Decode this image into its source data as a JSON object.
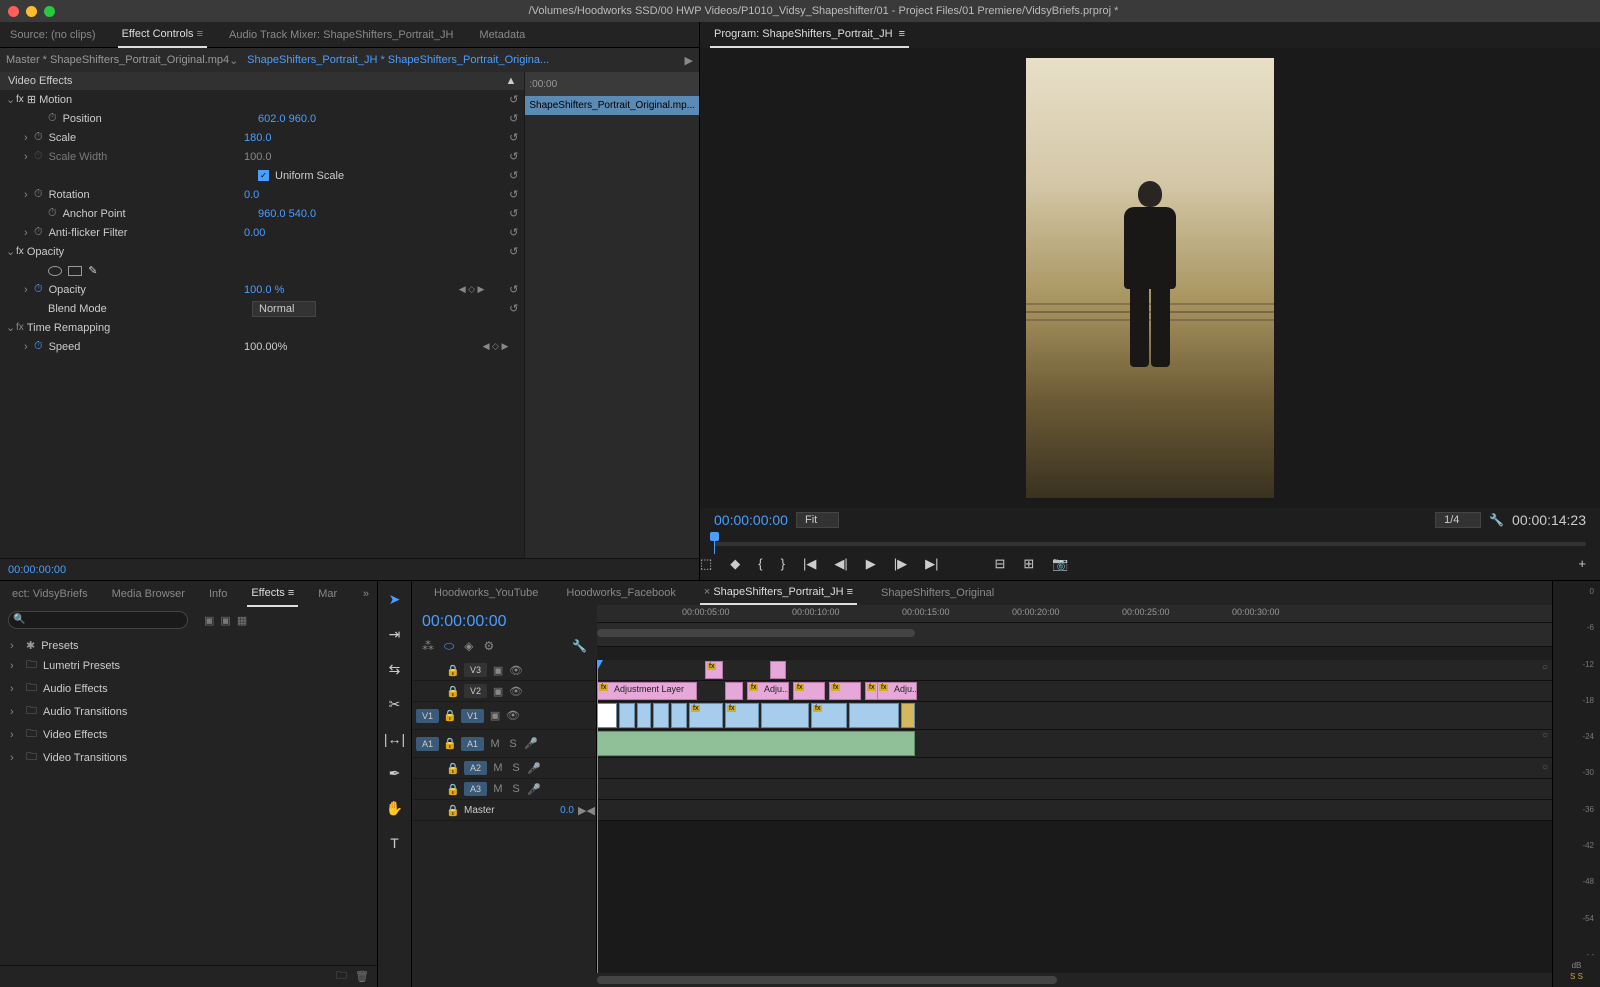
{
  "window": {
    "title": "/Volumes/Hoodworks SSD/00 HWP Videos/P1010_Vidsy_Shapeshifter/01 - Project Files/01 Premiere/VidsyBriefs.prproj *"
  },
  "source_tabs": {
    "source": "Source: (no clips)",
    "effect_controls": "Effect Controls",
    "audio_mixer": "Audio Track Mixer: ShapeShifters_Portrait_JH",
    "metadata": "Metadata"
  },
  "effect_controls": {
    "master": "Master * ShapeShifters_Portrait_Original.mp4",
    "clip_name": "ShapeShifters_Portrait_JH * ShapeShifters_Portrait_Origina...",
    "timeline_timecode": ":00:00",
    "clip_bar_label": "ShapeShifters_Portrait_Original.mp...",
    "section_video_effects": "Video Effects",
    "motion": {
      "label": "Motion",
      "position_label": "Position",
      "position_val": "602.0    960.0",
      "scale_label": "Scale",
      "scale_val": "180.0",
      "scale_width_label": "Scale Width",
      "scale_width_val": "100.0",
      "uniform_scale": "Uniform Scale",
      "rotation_label": "Rotation",
      "rotation_val": "0.0",
      "anchor_label": "Anchor Point",
      "anchor_val": "960.0    540.0",
      "antiflicker_label": "Anti-flicker Filter",
      "antiflicker_val": "0.00"
    },
    "opacity": {
      "label": "Opacity",
      "opacity_label": "Opacity",
      "opacity_val": "100.0 %",
      "blend_label": "Blend Mode",
      "blend_val": "Normal"
    },
    "time_remap": {
      "label": "Time Remapping",
      "speed_label": "Speed",
      "speed_val": "100.00%"
    },
    "footer_tc": "00:00:00:00"
  },
  "program": {
    "title": "Program: ShapeShifters_Portrait_JH",
    "timecode_left": "00:00:00:00",
    "fit": "Fit",
    "zoom": "1/4",
    "timecode_right": "00:00:14:23"
  },
  "project_tabs": {
    "project": "ect: VidsyBriefs",
    "media_browser": "Media Browser",
    "info": "Info",
    "effects": "Effects",
    "markers": "Mar"
  },
  "effects_tree": {
    "items": [
      "Presets",
      "Lumetri Presets",
      "Audio Effects",
      "Audio Transitions",
      "Video Effects",
      "Video Transitions"
    ]
  },
  "timeline": {
    "sequences": [
      "Hoodworks_YouTube",
      "Hoodworks_Facebook",
      "ShapeShifters_Portrait_JH",
      "ShapeShifters_Original"
    ],
    "active_seq_idx": 2,
    "timecode": "00:00:00:00",
    "ruler_marks": [
      "00:00:05:00",
      "00:00:10:00",
      "00:00:15:00",
      "00:00:20:00",
      "00:00:25:00",
      "00:00:30:00"
    ],
    "tracks": {
      "v3": "V3",
      "v2": "V2",
      "v1": "V1",
      "a1": "A1",
      "a2": "A2",
      "a3": "A3",
      "master": "Master",
      "master_val": "0.0"
    },
    "clips": {
      "adjustment_layer": "Adjustment Layer",
      "adju": "Adju..."
    }
  },
  "audio_meter": {
    "scale": [
      "0",
      "-6",
      "-12",
      "-18",
      "-24",
      "-30",
      "-36",
      "-42",
      "-48",
      "-54",
      "- -"
    ],
    "label": "dB",
    "solo": "S  S"
  }
}
